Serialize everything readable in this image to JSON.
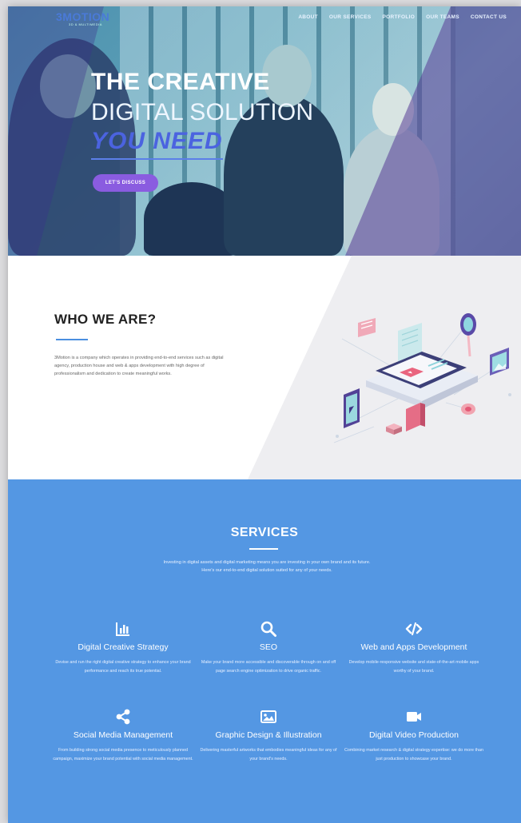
{
  "nav": {
    "logo": "3MOTION",
    "logo_tagline": "3D & MULTIMEDIA",
    "links": [
      "ABOUT",
      "OUR SERVICES",
      "PORTFOLIO",
      "OUR TEAMS",
      "CONTACT US"
    ]
  },
  "hero": {
    "line1": "THE CREATIVE",
    "line2": "DIGITAL SOLUTION",
    "line3": "YOU NEED",
    "cta": "LET'S DISCUSS"
  },
  "about": {
    "title": "WHO WE ARE?",
    "text": "3Motion is a company which operates in providing end-to-end services such as digital agency, production house and web & apps development with high degree of professionalism and dedication to create meaningful works."
  },
  "services": {
    "title": "SERVICES",
    "intro": "Investing in digital assets and digital marketing means you are investing in your own brand and its future. Here's our end-to-end digital solution suited for any of your needs.",
    "items": [
      {
        "icon": "bar-chart-icon",
        "name": "Digital Creative Strategy",
        "desc": "Devise and run the right digital creative strategy to enhance your brand performance and reach its true potential."
      },
      {
        "icon": "search-icon",
        "name": "SEO",
        "desc": "Make your brand more accessible and discoverable through on and off page search engine optimization to drive organic traffic."
      },
      {
        "icon": "code-icon",
        "name": "Web and Apps Development",
        "desc": "Develop mobile-responsive website and state-of-the-art mobile apps worthy of your brand."
      },
      {
        "icon": "share-icon",
        "name": "Social Media Management",
        "desc": "From building strong social media presence to meticulously planned campaign, maximize your brand potential with social media management."
      },
      {
        "icon": "image-icon",
        "name": "Graphic Design & Illustration",
        "desc": "Delivering masterful artworks that embodies meaningful ideas for any of your brand's needs."
      },
      {
        "icon": "video-camera-icon",
        "name": "Digital Video Production",
        "desc": "Combining market research & digital strategy expertise: we do more than just production to showcase your brand."
      }
    ]
  },
  "colors": {
    "services_bg": "#5497e3",
    "accent_blue": "#4b63e0",
    "cta_purple": "#8a5ce0",
    "heading_dark": "#222222"
  }
}
